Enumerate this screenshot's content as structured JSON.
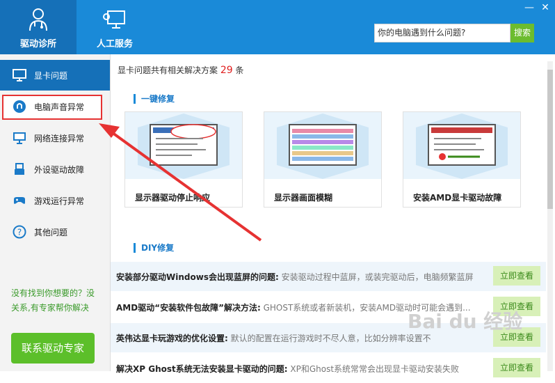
{
  "header": {
    "nav": [
      {
        "label": "驱动诊所",
        "icon": "doctor-icon"
      },
      {
        "label": "人工服务",
        "icon": "service-computer-icon"
      }
    ],
    "window_buttons": {
      "minimize": "—",
      "close": "✕"
    },
    "search": {
      "placeholder": "你的电脑遇到什么问题?",
      "button_label": "搜索"
    }
  },
  "sidebar": {
    "items": [
      {
        "label": "显卡问题",
        "icon": "monitor-icon",
        "active": true
      },
      {
        "label": "电脑声音异常",
        "icon": "speaker-icon",
        "active": false
      },
      {
        "label": "网络连接异常",
        "icon": "network-monitor-icon",
        "active": false
      },
      {
        "label": "外设驱动故障",
        "icon": "usb-icon",
        "active": false
      },
      {
        "label": "游戏运行异常",
        "icon": "gamepad-icon",
        "active": false
      },
      {
        "label": "其他问题",
        "icon": "question-icon",
        "active": false
      }
    ],
    "help_text": "没有找到你想要的？没关系,有专家帮你解决",
    "contact_button": "联系驱动专家"
  },
  "main": {
    "summary_prefix": "显卡问题共有相关解决方案",
    "summary_count": "29",
    "summary_suffix": "条",
    "quick_fix_title": "一键修复",
    "cards": [
      {
        "label": "显示器驱动停止响应"
      },
      {
        "label": "显示器画面模糊"
      },
      {
        "label": "安装AMD显卡驱动故障"
      }
    ],
    "diy_title": "DIY修复",
    "diy_items": [
      {
        "title": "安装部分驱动Windows会出现蓝屏的问题:",
        "desc": "安装驱动过程中蓝屏，或装完驱动后，电脑频繁蓝屏",
        "button": "立即查看"
      },
      {
        "title": "AMD驱动“安装软件包故障”解决方法:",
        "desc": "GHOST系统或者新装机，安装AMD驱动时可能会遇到...",
        "button": "立即查看"
      },
      {
        "title": "英伟达显卡玩游戏的优化设置:",
        "desc": "默认的配置在运行游戏时不尽人意，比如分辨率设置不",
        "button": "立即查看"
      },
      {
        "title": "解决XP Ghost系统无法安装显卡驱动的问题:",
        "desc": "XP和Ghost系统常常会出现显卡驱动安装失败",
        "button": "立即查看"
      }
    ]
  },
  "colors": {
    "header_blue": "#1a8ad8",
    "accent_green": "#5cbf2a",
    "highlight_red": "#e63232"
  },
  "watermark": "Bai du 经验"
}
